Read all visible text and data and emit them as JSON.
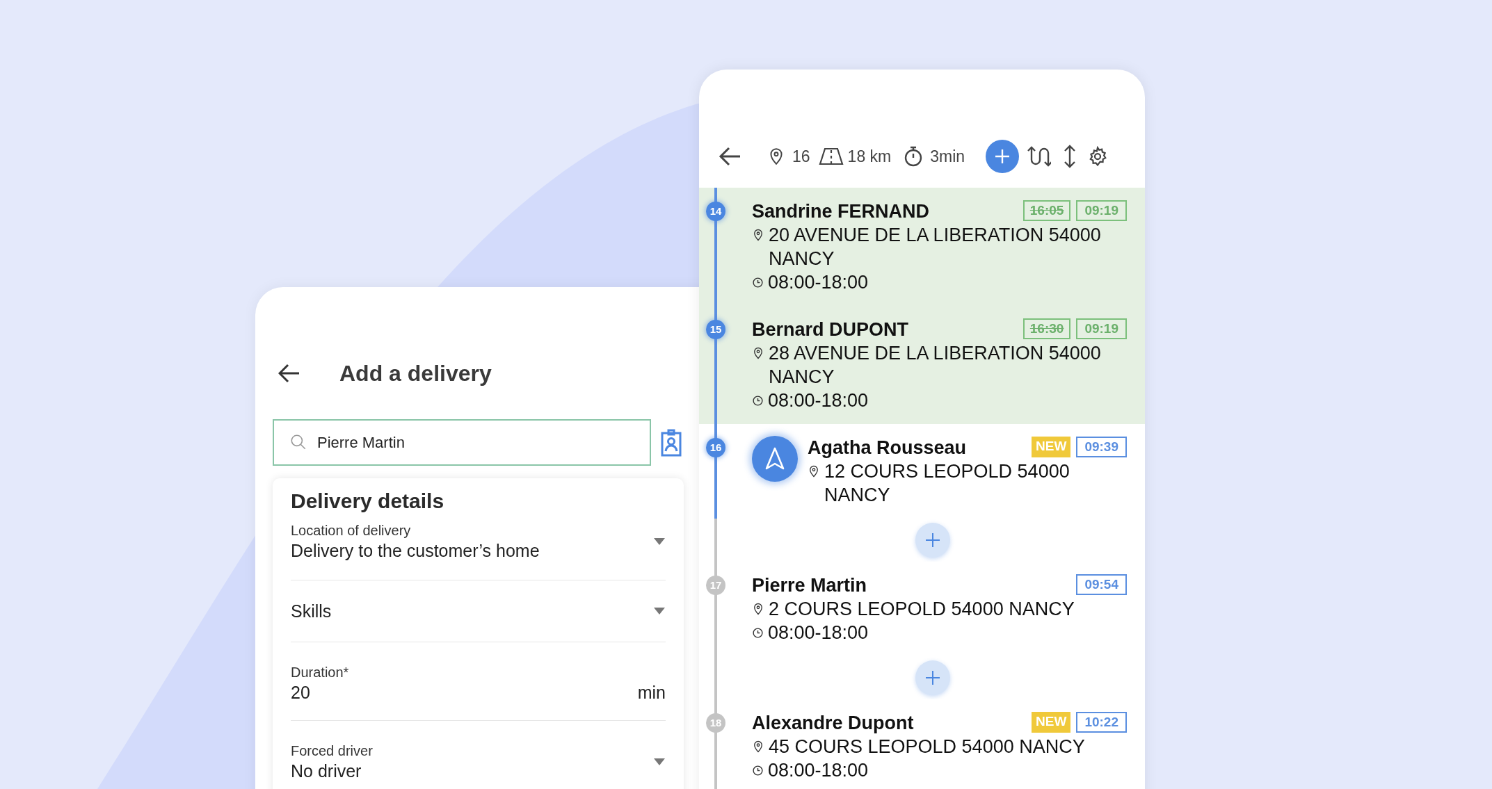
{
  "delivery_form": {
    "title": "Add a delivery",
    "search": {
      "value": "Pierre Martin"
    },
    "section_title": "Delivery details",
    "fields": [
      {
        "kind": "select",
        "label": "Location of delivery",
        "value": "Delivery to the customer’s home"
      },
      {
        "kind": "select",
        "value": "Skills"
      },
      {
        "kind": "number",
        "label": "Duration*",
        "value": "20",
        "unit": "min"
      },
      {
        "kind": "select",
        "label": "Forced driver",
        "value": "No driver"
      }
    ]
  },
  "route": {
    "stats": {
      "stops": "16",
      "distance": "18 km",
      "duration": "3min"
    },
    "items": [
      {
        "kind": "stop",
        "number": "14",
        "completed": true,
        "active": false,
        "name": "Sandrine FERNAND",
        "address": "20 AVENUE DE LA LIBERATION 54000 NANCY",
        "window": "08:00-18:00",
        "old_time": "16:05",
        "time": "09:19"
      },
      {
        "kind": "stop",
        "number": "15",
        "completed": true,
        "active": false,
        "name": "Bernard DUPONT",
        "address": "28 AVENUE DE LA LIBERATION 54000 NANCY",
        "window": "08:00-18:00",
        "old_time": "16:30",
        "time": "09:19"
      },
      {
        "kind": "stop",
        "number": "16",
        "completed": false,
        "active": true,
        "name": "Agatha Rousseau",
        "address": "12 COURS LEOPOLD 54000 NANCY",
        "badge": "NEW",
        "time": "09:39"
      },
      {
        "kind": "add"
      },
      {
        "kind": "stop",
        "number": "17",
        "completed": false,
        "active": false,
        "name": "Pierre Martin",
        "address": "2 COURS LEOPOLD 54000 NANCY",
        "window": "08:00-18:00",
        "time": "09:54"
      },
      {
        "kind": "add"
      },
      {
        "kind": "stop",
        "number": "18",
        "completed": false,
        "active": false,
        "name": "Alexandre Dupont",
        "address": "45 COURS LEOPOLD 54000 NANCY",
        "window": "08:00-18:00",
        "badge": "NEW",
        "time": "10:22"
      }
    ]
  }
}
